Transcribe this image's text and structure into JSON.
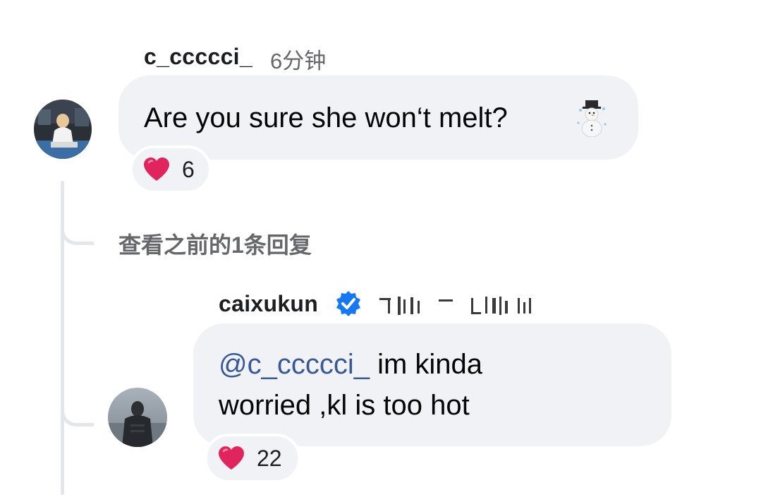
{
  "comment": {
    "username": "c_ccccci_",
    "timestamp": "6分钟",
    "text": "Are you sure she won‘t melt?",
    "emoji_name": "snowman-icon",
    "reaction_icon": "heart-icon",
    "reaction_count": "6"
  },
  "view_previous": {
    "label": "查看之前的1条回复"
  },
  "reply": {
    "username": "caixukun",
    "verified_icon": "verified-badge-icon",
    "mention": "@c_ccccci_",
    "text_line1": " im kinda",
    "text_line2": "worried ,kl is too hot",
    "reaction_icon": "heart-icon",
    "reaction_count": "22"
  },
  "colors": {
    "bubble": "#f0f2f5",
    "mention": "#385898",
    "verified": "#1877f2",
    "heart": "#e0245e",
    "muted_text": "#65676b"
  }
}
